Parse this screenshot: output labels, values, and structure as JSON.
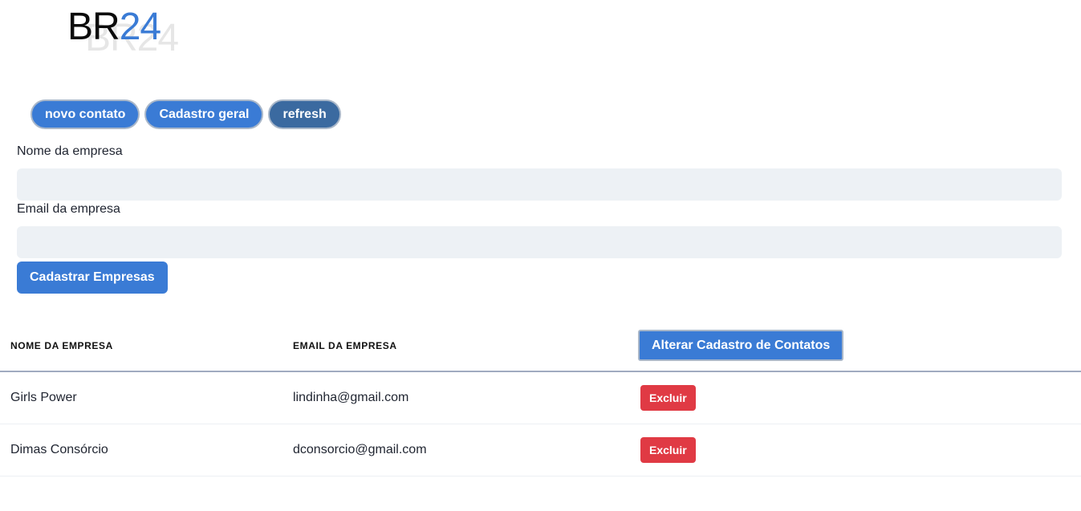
{
  "brand": {
    "logo_part1": "BR",
    "logo_part2": "24",
    "logo_shadow": "BR24"
  },
  "nav": {
    "items": [
      {
        "label": "novo contato"
      },
      {
        "label": "Cadastro geral"
      },
      {
        "label": "refresh"
      }
    ]
  },
  "form": {
    "company_name_label": "Nome da empresa",
    "company_name_value": "",
    "company_email_label": "Email da empresa",
    "company_email_value": "",
    "submit_label": "Cadastrar Empresas"
  },
  "table": {
    "headers": {
      "name": "NOME DA EMPRESA",
      "email": "EMAIL DA EMPRESA",
      "action_button": "Alterar Cadastro de Contatos"
    },
    "rows": [
      {
        "name": "Girls Power",
        "email": "lindinha@gmail.com",
        "delete_label": "Excluir"
      },
      {
        "name": "Dimas Consórcio",
        "email": "dconsorcio@gmail.com",
        "delete_label": "Excluir"
      }
    ]
  },
  "colors": {
    "primary": "#3a7bd5",
    "refresh": "#3b6aa0",
    "danger": "#e03a44",
    "field_bg": "#edf1f5"
  }
}
